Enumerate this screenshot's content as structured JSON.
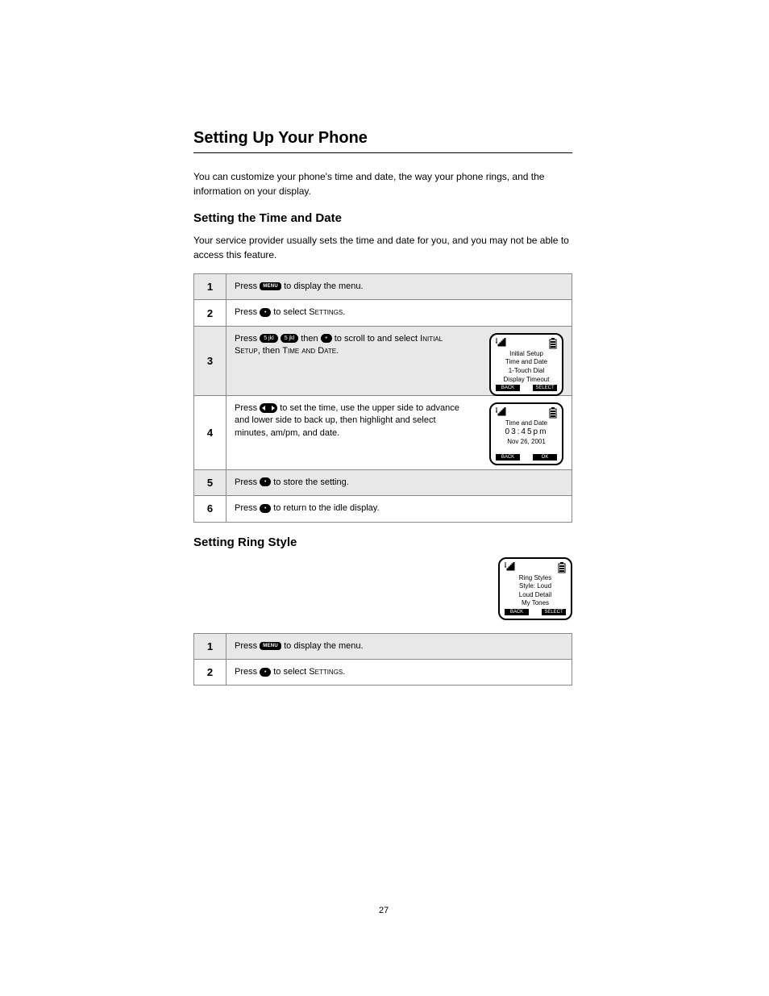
{
  "page": {
    "title": "Setting Up Your Phone",
    "intro": "You can customize your phone's time and date, the way your phone rings, and the information on your display.",
    "section1": {
      "heading": "Setting the Time and Date",
      "para": "Your service provider usually sets the time and date for you, and you may not be able to access this feature.",
      "steps": [
        {
          "num": "1",
          "action": [
            "Press ",
            {
              "key": "menu"
            },
            " to display the menu."
          ]
        },
        {
          "num": "2",
          "action": [
            "Press ",
            {
              "key": "ok"
            },
            " to select Settings."
          ]
        },
        {
          "num": "3",
          "action": [
            "Press ",
            {
              "key": "5"
            },
            " ",
            {
              "key": "5"
            },
            " then ",
            {
              "key": "ok"
            },
            " to scroll to and select Initial Setup, then Time and Date."
          ],
          "lcd": {
            "l1": "Initial Setup",
            "l2": "Time and Date",
            "l3": "1-Touch Dial",
            "l4": "Display Timeout",
            "left": "BACK",
            "right": "SELECT"
          }
        },
        {
          "num": "4",
          "action": [
            "Press ",
            {
              "key": "nav"
            },
            " to set the time, use the upper side to advance and lower side to back up, then highlight and select minutes, am/pm, and date."
          ],
          "lcd": {
            "l1": "Time and Date",
            "l2": "",
            "l3": "Nov 26, 2001",
            "l4": "",
            "left": "BACK",
            "right": "OK",
            "time": "03:45pm"
          }
        },
        {
          "num": "5",
          "action": [
            "Press ",
            {
              "key": "ok"
            },
            " to store the setting."
          ]
        },
        {
          "num": "6",
          "action": [
            "Press ",
            {
              "key": "ok"
            },
            " to return to the idle display."
          ]
        }
      ]
    },
    "section2": {
      "heading": "Setting Ring Style",
      "lcd": {
        "l1": "Ring Styles",
        "l2": "Style: Loud",
        "l3": "Loud Detail",
        "l4": "My Tones",
        "left": "BACK",
        "right": "SELECT"
      },
      "steps": [
        {
          "num": "1",
          "action": [
            "Press ",
            {
              "key": "menu"
            },
            " to display the menu."
          ]
        },
        {
          "num": "2",
          "action": [
            "Press ",
            {
              "key": "ok"
            },
            " to select Settings."
          ]
        }
      ]
    },
    "pagenum": "27"
  }
}
